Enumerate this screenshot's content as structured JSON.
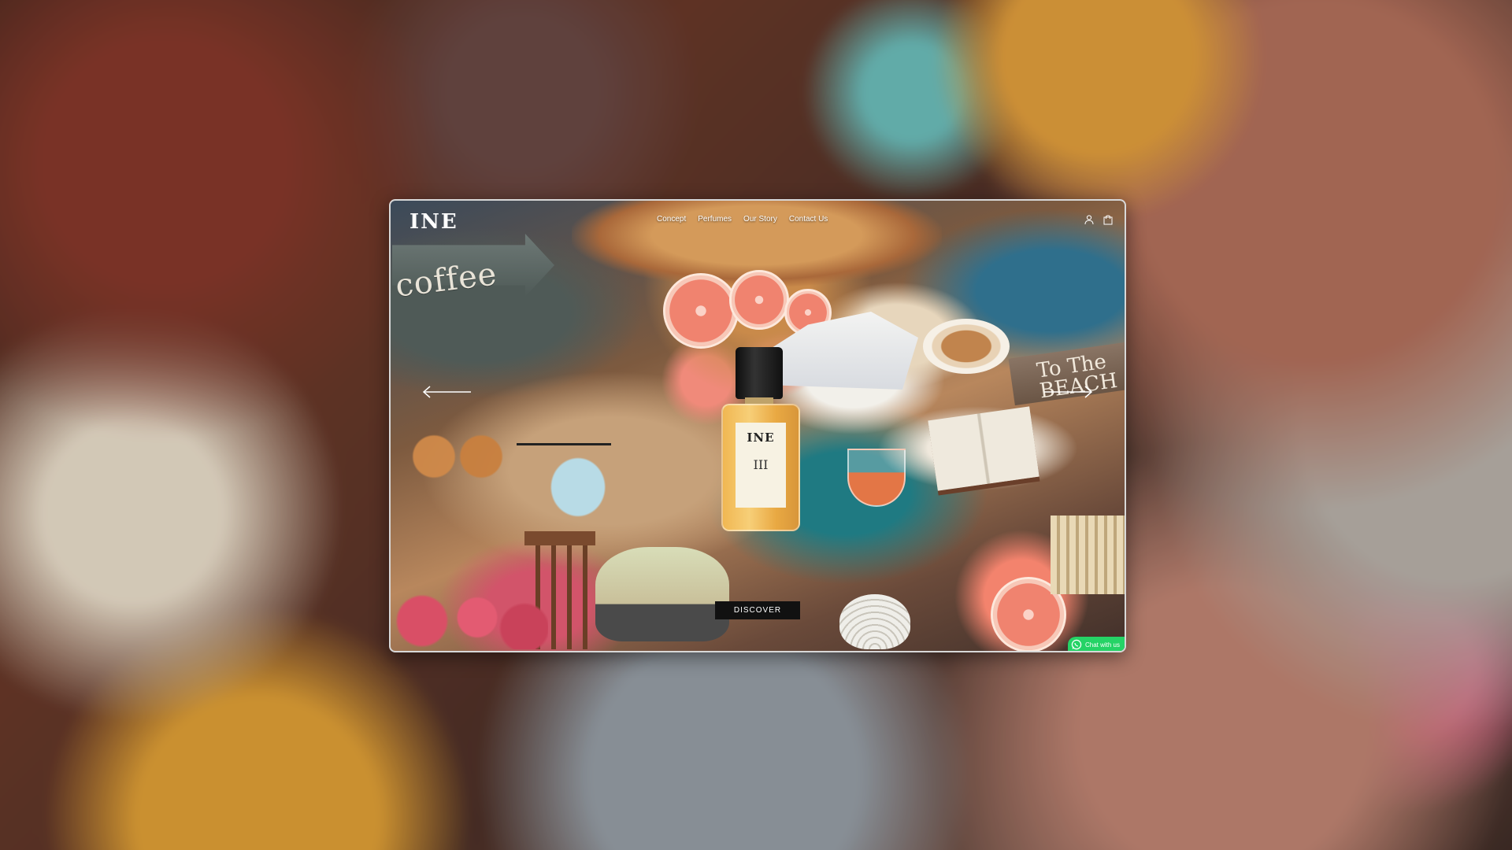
{
  "brand": {
    "logo_text": "INE"
  },
  "nav": {
    "items": [
      {
        "label": "Concept"
      },
      {
        "label": "Perfumes"
      },
      {
        "label": "Our Story"
      },
      {
        "label": "Contact Us"
      }
    ]
  },
  "header_icons": {
    "account": "user-icon",
    "cart": "shopping-bag-icon"
  },
  "hero": {
    "collage_signs": {
      "coffee": "coffee",
      "beach": "To The BEACH"
    },
    "bottle": {
      "logo": "INE",
      "number": "III"
    },
    "cta_label": "DISCOVER"
  },
  "carousel": {
    "prev": "arrow-left-icon",
    "next": "arrow-right-icon"
  },
  "chat": {
    "label": "Chat with us",
    "icon": "whatsapp-icon"
  },
  "colors": {
    "cta_background": "#111111",
    "chat_green": "#25d366",
    "frame_border": "#d8d8d8"
  }
}
